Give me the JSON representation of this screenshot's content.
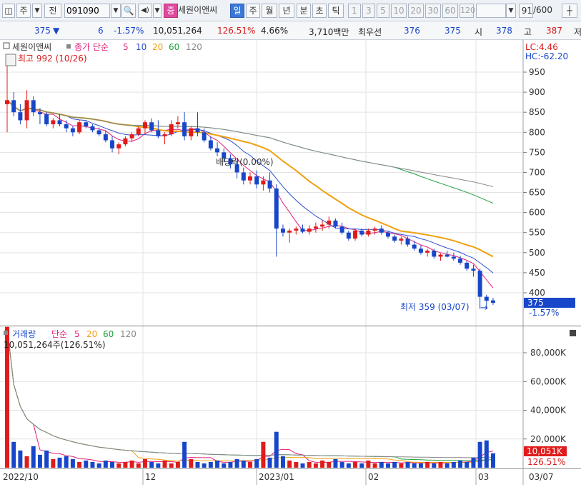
{
  "toolbar": {
    "market": "주",
    "period": "전",
    "code": "091090",
    "mode_badge": "증",
    "stock_name": "세원이앤씨",
    "tabs": [
      "일",
      "주",
      "월",
      "년",
      "분",
      "초",
      "틱"
    ],
    "active_tab": "일",
    "intervals": [
      "1",
      "3",
      "5",
      "10",
      "20",
      "30",
      "60",
      "120"
    ],
    "count": "91",
    "count_total": "/600"
  },
  "quote": {
    "price": "375",
    "direction": "▼",
    "change": "6",
    "change_pct": "-1.57%",
    "volume": "10,051,264",
    "volume_ratio": "126.51%",
    "turnover": "4.66%",
    "amount": "3,710백만",
    "best_ask_label": "최우선",
    "best_ask": "376",
    "best_bid": "375",
    "open_label": "시",
    "open": "378",
    "high_label": "고",
    "high": "387",
    "low_label": "저"
  },
  "price_panel": {
    "legend_name": "세원이앤씨",
    "legend_ma_title": "종가 단순",
    "legend_ma_periods": [
      "5",
      "10",
      "20",
      "60",
      "120"
    ],
    "high_marker": "최고 992 (10/26)",
    "low_marker": "최저 359 (03/07)",
    "lc": "LC:4.46",
    "hc": "HC:-62.20",
    "event_label": "배당락(0.00%)",
    "current_price": "375",
    "current_change": "-1.57%",
    "y_ticks": [
      "950",
      "900",
      "850",
      "800",
      "750",
      "700",
      "650",
      "600",
      "550",
      "500",
      "450",
      "400"
    ]
  },
  "volume_panel": {
    "legend_title": "거래량",
    "legend_ma_title": "단순",
    "legend_ma_periods": [
      "5",
      "20",
      "60",
      "120"
    ],
    "info": "10,051,264주(126.51%)",
    "current_volume": "10,051K",
    "current_ratio": "126.51%",
    "y_ticks": [
      "80,000K",
      "60,000K",
      "40,000K",
      "20,000K"
    ]
  },
  "x_axis": {
    "labels": [
      "2022/10",
      "12",
      "2023/01",
      "02",
      "03"
    ],
    "current_date": "03/07"
  },
  "colors": {
    "up": "#e01b1b",
    "down": "#1846c9",
    "ma5": "#e0207a",
    "ma10": "#3050d0",
    "ma20": "#f0a010",
    "ma60": "#20a040",
    "ma120": "#888888"
  },
  "chart_data": {
    "type": "candlestick",
    "x": [
      "2022/10",
      "12",
      "2023/01",
      "02",
      "03"
    ],
    "ohlc": [
      [
        870,
        992,
        800,
        880
      ],
      [
        880,
        900,
        840,
        850
      ],
      [
        850,
        870,
        820,
        830
      ],
      [
        830,
        905,
        810,
        880
      ],
      [
        880,
        890,
        840,
        850
      ],
      [
        850,
        860,
        820,
        845
      ],
      [
        845,
        850,
        815,
        820
      ],
      [
        820,
        835,
        810,
        830
      ],
      [
        830,
        845,
        815,
        820
      ],
      [
        820,
        830,
        800,
        810
      ],
      [
        810,
        815,
        790,
        800
      ],
      [
        800,
        830,
        795,
        825
      ],
      [
        825,
        830,
        810,
        815
      ],
      [
        815,
        820,
        800,
        805
      ],
      [
        805,
        812,
        790,
        795
      ],
      [
        795,
        805,
        775,
        780
      ],
      [
        780,
        790,
        750,
        760
      ],
      [
        760,
        775,
        745,
        770
      ],
      [
        770,
        790,
        765,
        785
      ],
      [
        785,
        800,
        775,
        795
      ],
      [
        795,
        815,
        790,
        810
      ],
      [
        810,
        830,
        795,
        825
      ],
      [
        825,
        835,
        800,
        805
      ],
      [
        805,
        830,
        785,
        790
      ],
      [
        790,
        800,
        770,
        795
      ],
      [
        795,
        830,
        790,
        820
      ],
      [
        820,
        840,
        810,
        825
      ],
      [
        825,
        850,
        780,
        790
      ],
      [
        790,
        815,
        780,
        810
      ],
      [
        810,
        850,
        790,
        800
      ],
      [
        800,
        810,
        775,
        780
      ],
      [
        780,
        790,
        755,
        760
      ],
      [
        760,
        775,
        740,
        750
      ],
      [
        750,
        760,
        725,
        735
      ],
      [
        735,
        745,
        710,
        720
      ],
      [
        720,
        730,
        685,
        700
      ],
      [
        700,
        712,
        670,
        680
      ],
      [
        680,
        700,
        670,
        690
      ],
      [
        690,
        705,
        660,
        670
      ],
      [
        670,
        690,
        655,
        680
      ],
      [
        680,
        700,
        650,
        660
      ],
      [
        660,
        670,
        490,
        560
      ],
      [
        560,
        570,
        540,
        550
      ],
      [
        550,
        560,
        525,
        555
      ],
      [
        555,
        565,
        545,
        560
      ],
      [
        560,
        570,
        548,
        552
      ],
      [
        552,
        568,
        545,
        560
      ],
      [
        560,
        575,
        550,
        565
      ],
      [
        565,
        580,
        555,
        570
      ],
      [
        570,
        590,
        560,
        580
      ],
      [
        580,
        585,
        560,
        565
      ],
      [
        565,
        575,
        545,
        550
      ],
      [
        550,
        555,
        530,
        535
      ],
      [
        535,
        560,
        530,
        555
      ],
      [
        555,
        560,
        540,
        545
      ],
      [
        545,
        560,
        540,
        555
      ],
      [
        555,
        565,
        545,
        560
      ],
      [
        560,
        568,
        545,
        550
      ],
      [
        550,
        555,
        535,
        540
      ],
      [
        540,
        545,
        525,
        530
      ],
      [
        530,
        540,
        520,
        535
      ],
      [
        535,
        540,
        515,
        520
      ],
      [
        520,
        530,
        505,
        510
      ],
      [
        510,
        518,
        495,
        500
      ],
      [
        500,
        510,
        490,
        505
      ],
      [
        505,
        510,
        485,
        490
      ],
      [
        490,
        498,
        480,
        495
      ],
      [
        495,
        505,
        488,
        490
      ],
      [
        490,
        500,
        480,
        485
      ],
      [
        485,
        492,
        470,
        475
      ],
      [
        475,
        480,
        455,
        460
      ],
      [
        460,
        470,
        440,
        455
      ],
      [
        455,
        460,
        360,
        390
      ],
      [
        390,
        395,
        359,
        380
      ],
      [
        381,
        387,
        370,
        375
      ]
    ],
    "volume_k": [
      98000,
      18000,
      12000,
      8000,
      15000,
      9000,
      12000,
      6000,
      7000,
      8000,
      6000,
      4000,
      5000,
      4000,
      3000,
      5000,
      4000,
      3000,
      4000,
      5000,
      3000,
      6000,
      4000,
      3000,
      5000,
      3000,
      4000,
      18000,
      6000,
      4000,
      3000,
      4000,
      5000,
      3000,
      4000,
      6000,
      5000,
      4000,
      6000,
      18000,
      7000,
      25000,
      8000,
      5000,
      4000,
      3000,
      4000,
      3000,
      5000,
      4000,
      6000,
      4000,
      3000,
      4000,
      3000,
      5000,
      3000,
      4000,
      3000,
      4000,
      3000,
      4000,
      3000,
      3000,
      4000,
      3000,
      4000,
      3000,
      4000,
      5000,
      4000,
      7000,
      18000,
      19000,
      10051
    ],
    "ylim_price": [
      359,
      992
    ],
    "ylim_volume": [
      0,
      90000
    ],
    "series": [
      {
        "name": "5"
      },
      {
        "name": "10"
      },
      {
        "name": "20"
      },
      {
        "name": "60"
      },
      {
        "name": "120"
      }
    ]
  }
}
